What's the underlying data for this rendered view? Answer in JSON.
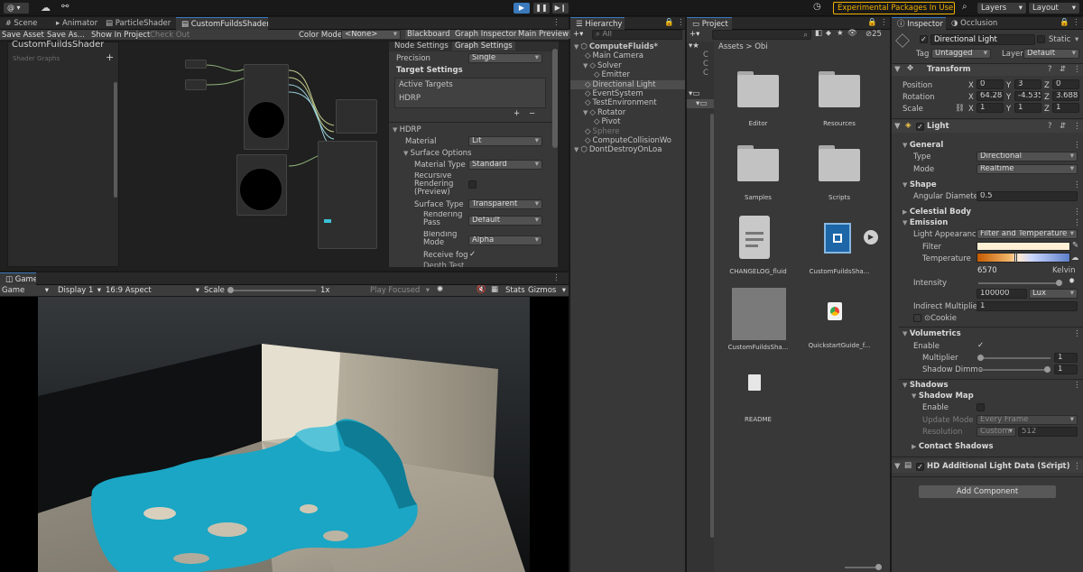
{
  "topbar": {
    "account_label": "@",
    "experimental_label": "Experimental Packages In Use",
    "layers_label": "Layers",
    "layout_label": "Layout"
  },
  "scene_tabs": [
    "Scene",
    "Animator",
    "ParticleShader",
    "CustomFuildsShader"
  ],
  "shader_toolbar": {
    "save_asset": "Save Asset",
    "save_as": "Save As...",
    "show_in_project": "Show In Project",
    "check_out": "Check Out",
    "color_mode_label": "Color Mode",
    "color_mode_value": "<None>",
    "blackboard": "Blackboard",
    "graph_inspector": "Graph Inspector",
    "main_preview": "Main Preview"
  },
  "blackboard": {
    "title": "CustomFuildsShader",
    "subtitle": "Shader Graphs",
    "add_icon": "+"
  },
  "graph_inspector": {
    "tabs": [
      "Node Settings",
      "Graph Settings"
    ],
    "precision_label": "Precision",
    "precision_value": "Single",
    "target_settings": "Target Settings",
    "active_targets": "Active Targets",
    "target_item": "HDRP",
    "hdrp_section": "HDRP",
    "material_label": "Material",
    "material_value": "Lit",
    "surface_options": "Surface Options",
    "material_type_label": "Material Type",
    "material_type_value": "Standard",
    "recursive_label": "Recursive Rendering (Preview)",
    "surface_type_label": "Surface Type",
    "surface_type_value": "Transparent",
    "rendering_pass_label": "Rendering Pass",
    "rendering_pass_value": "Default",
    "blending_label": "Blending Mode",
    "blending_value": "Alpha",
    "receive_fog_label": "Receive fog",
    "depth_test_label": "Depth Test"
  },
  "game": {
    "tab": "Game",
    "display_mode": "Game",
    "display": "Display 1",
    "aspect": "16:9 Aspect",
    "scale_label": "Scale",
    "scale_value": "1x",
    "play_focused": "Play Focused",
    "stats": "Stats",
    "gizmos": "Gizmos"
  },
  "hierarchy": {
    "tab": "Hierarchy",
    "search_placeholder": "All",
    "items": [
      {
        "label": "ComputeFluids*",
        "depth": 0,
        "bold": true
      },
      {
        "label": "Main Camera",
        "depth": 1
      },
      {
        "label": "Solver",
        "depth": 1
      },
      {
        "label": "Emitter",
        "depth": 2
      },
      {
        "label": "Directional Light",
        "depth": 1,
        "selected": true
      },
      {
        "label": "EventSystem",
        "depth": 1
      },
      {
        "label": "TestEnvironment",
        "depth": 1
      },
      {
        "label": "Rotator",
        "depth": 1
      },
      {
        "label": "Pivot",
        "depth": 2
      },
      {
        "label": "Sphere",
        "depth": 1,
        "dim": true
      },
      {
        "label": "ComputeCollisionWo",
        "depth": 1
      },
      {
        "label": "DontDestroyOnLoa",
        "depth": 0
      }
    ]
  },
  "project": {
    "tab": "Project",
    "breadcrumb_root": "Assets",
    "breadcrumb_sep": ">",
    "breadcrumb_current": "Obi",
    "count_badge": "25",
    "assets": [
      {
        "name": "Editor",
        "kind": "folder"
      },
      {
        "name": "Resources",
        "kind": "folder"
      },
      {
        "name": "Samples",
        "kind": "folder"
      },
      {
        "name": "Scripts",
        "kind": "folder"
      },
      {
        "name": "CHANGELOG_fluid",
        "kind": "doc"
      },
      {
        "name": "CustomFuildsSha...",
        "kind": "shadergraph"
      },
      {
        "name": "CustomFuildsSha...",
        "kind": "material"
      },
      {
        "name": "QuickstartGuide_f...",
        "kind": "chrome"
      },
      {
        "name": "README",
        "kind": "file"
      }
    ]
  },
  "inspector": {
    "tabs": [
      "Inspector",
      "Occlusion"
    ],
    "object_name": "Directional Light",
    "static_label": "Static",
    "tag_label": "Tag",
    "tag_value": "Untagged",
    "layer_label": "Layer",
    "layer_value": "Default",
    "transform": {
      "title": "Transform",
      "position_label": "Position",
      "rotation_label": "Rotation",
      "scale_label": "Scale",
      "axis": [
        "X",
        "Y",
        "Z"
      ],
      "position": [
        "0",
        "3",
        "0"
      ],
      "rotation": [
        "64.284",
        "-4.535",
        "3.688"
      ],
      "scale": [
        "1",
        "1",
        "1"
      ]
    },
    "light": {
      "title": "Light",
      "general": "General",
      "type_label": "Type",
      "type_value": "Directional",
      "mode_label": "Mode",
      "mode_value": "Realtime",
      "shape": "Shape",
      "angular_label": "Angular Diameter",
      "angular_value": "0.5",
      "celestial": "Celestial Body",
      "emission": "Emission",
      "appearance_label": "Light Appearance",
      "appearance_value": "Filter and Temperature",
      "filter_label": "Filter",
      "temperature_label": "Temperature",
      "temperature_value": "6570",
      "temperature_unit": "Kelvin",
      "intensity_label": "Intensity",
      "intensity_value": "100000",
      "intensity_unit": "Lux",
      "indirect_label": "Indirect Multiplier",
      "indirect_value": "1",
      "cookie_label": "Cookie",
      "volumetrics": "Volumetrics",
      "enable_label": "Enable",
      "multiplier_label": "Multiplier",
      "multiplier_value": "1",
      "shadow_dim_label": "Shadow Dimme",
      "shadow_dim_value": "1",
      "shadows": "Shadows",
      "shadow_map": "Shadow Map",
      "sm_enable_label": "Enable",
      "update_mode_label": "Update Mode",
      "update_mode_value": "Every Frame",
      "resolution_label": "Resolution",
      "resolution_value": "Custom",
      "resolution_number": "512",
      "contact_shadows": "Contact Shadows"
    },
    "hd_data": "HD Additional Light Data (Script)",
    "add_component": "Add Component"
  },
  "colors": {
    "accent": "#3a79bb",
    "selection": "#2c5d87",
    "fluid": "#1aa6c4",
    "experimental": "#f0b000"
  }
}
